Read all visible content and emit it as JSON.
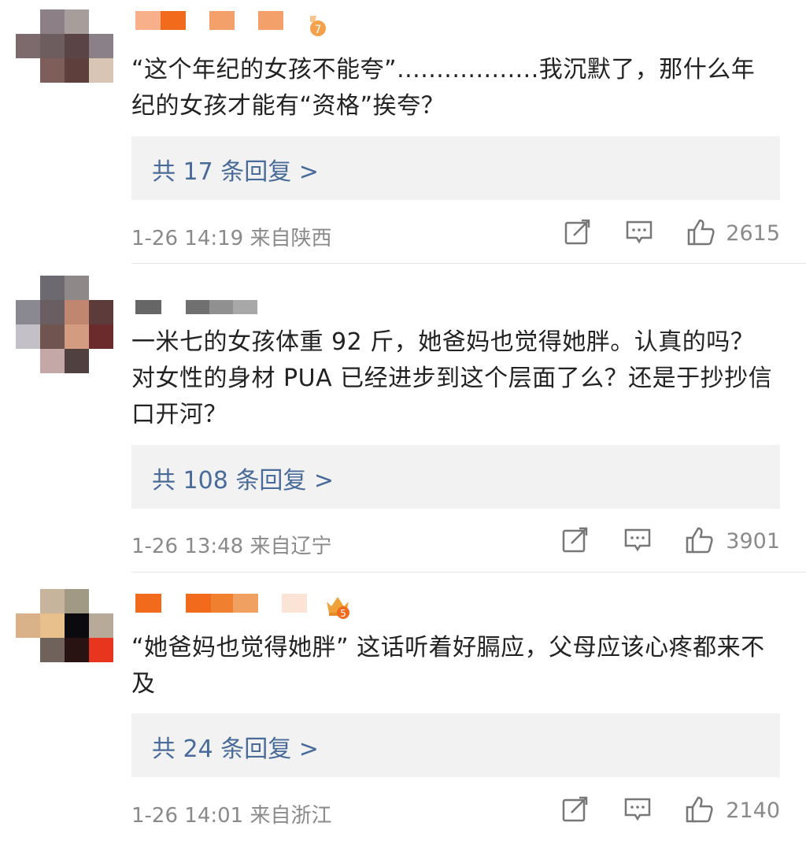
{
  "comments": [
    {
      "text": "“这个年纪的女孩不能夸”..................我沉默了，那什么年纪的女孩才能有“资格”挨夸？",
      "replies": "共 17 条回复 >",
      "time": "1-26 14:19 来自陕西",
      "likes": "2615",
      "badge": "7",
      "badge_color": "#f5a623",
      "name_colors": [
        "#f7b08a",
        "#f26a1b",
        "#f3a06a",
        "#f08a3a"
      ]
    },
    {
      "text": "一米七的女孩体重 92 斤，她爸妈也觉得她胖。认真的吗？对女性的身材 PUA 已经进步到这个层面了么？还是于抄抄信口开河？",
      "replies": "共 108 条回复 >",
      "time": "1-26 13:48 来自辽宁",
      "likes": "3901",
      "name_colors": [
        "#666666",
        "#7a7a7a",
        "#9a9a9a",
        "#b0b0b0"
      ]
    },
    {
      "text": "“她爸妈也觉得她胖” 这话听着好膈应，父母应该心疼都来不及",
      "replies": "共 24 条回复 >",
      "time": "1-26 14:01 来自浙江",
      "likes": "2140",
      "badge": "5",
      "badge_color": "#f5a623",
      "name_colors": [
        "#f26a1b",
        "#f07a2a",
        "#f0a060",
        "#fbe3d6"
      ]
    }
  ],
  "colors": {
    "link": "#496b99",
    "meta": "#8a8a8a",
    "reply_bg": "#f2f2f2"
  },
  "icons": [
    "share-edit-icon",
    "comment-bubble-icon",
    "thumbs-up-icon"
  ]
}
